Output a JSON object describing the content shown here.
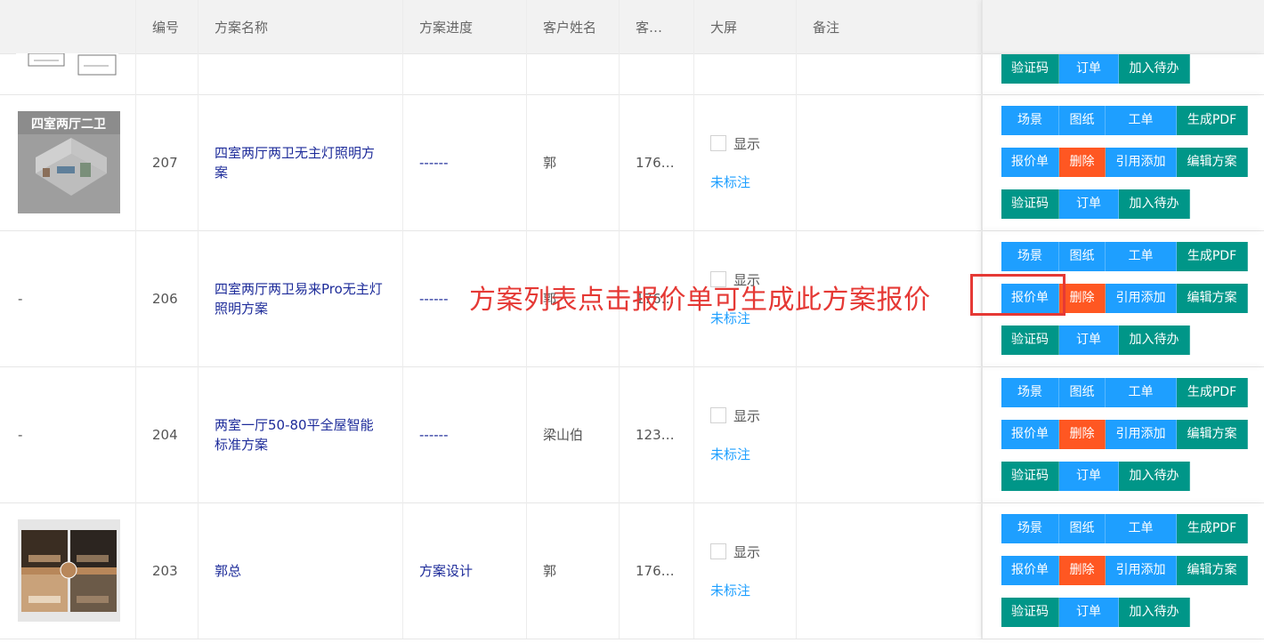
{
  "table": {
    "headers": [
      "",
      "编号",
      "方案名称",
      "方案进度",
      "客户姓名",
      "客…",
      "大屏",
      "备注",
      ""
    ],
    "checkbox_label": "显示",
    "mark_label": "未标注",
    "buttons": {
      "scene": "场景",
      "drawing": "图纸",
      "workorder": "工单",
      "pdf": "生成PDF",
      "quote": "报价单",
      "delete": "删除",
      "cite": "引用添加",
      "edit": "编辑方案",
      "verify": "验证码",
      "order": "订单",
      "todo": "加入待办"
    },
    "rows": [
      {
        "id": "207",
        "name": "四室两厅两卫无主灯照明方案",
        "progress": "------",
        "customer": "郭",
        "phone": "176…",
        "thumb": "四室两厅二卫",
        "thumb_kind": "render"
      },
      {
        "id": "206",
        "name": "四室两厅两卫易来Pro无主灯照明方案",
        "progress": "------",
        "customer": "郭",
        "phone": "176…",
        "thumb": "-",
        "thumb_kind": "none"
      },
      {
        "id": "204",
        "name": "两室一厅50-80平全屋智能标准方案",
        "progress": "------",
        "customer": "梁山伯",
        "phone": "123…",
        "thumb": "-",
        "thumb_kind": "none"
      },
      {
        "id": "203",
        "name": "郭总",
        "progress": "方案设计",
        "customer": "郭",
        "phone": "176…",
        "thumb": "",
        "thumb_kind": "photo"
      }
    ]
  },
  "annotation": "方案列表点击报价单可生成此方案报价",
  "colors": {
    "blue": "#1e9fff",
    "green": "#009688",
    "orange": "#ff5722",
    "link": "#1e2c9a",
    "annotation": "#e53935"
  }
}
